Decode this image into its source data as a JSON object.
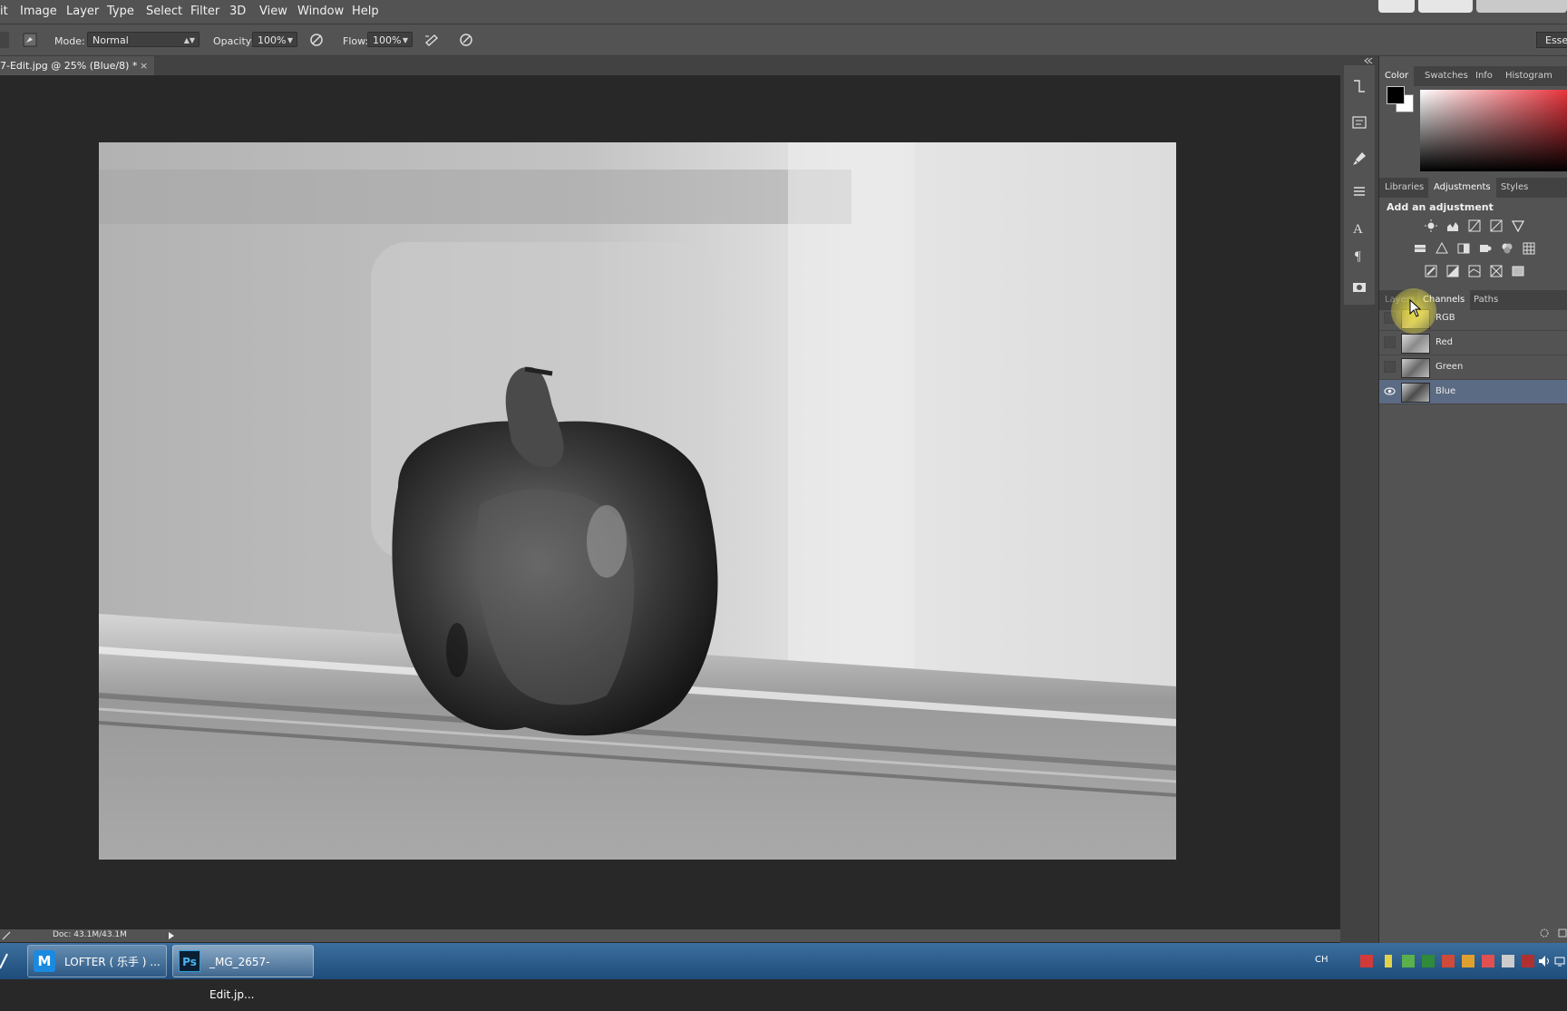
{
  "menu": {
    "items": [
      "it",
      "Image",
      "Layer",
      "Type",
      "Select",
      "Filter",
      "3D",
      "View",
      "Window",
      "Help"
    ]
  },
  "options": {
    "mode_label": "Mode:",
    "mode_value": "Normal",
    "opacity_label": "Opacity:",
    "opacity_value": "100%",
    "flow_label": "Flow:",
    "flow_value": "100%",
    "workspace": "Esser"
  },
  "document": {
    "tab_title": "7-Edit.jpg @ 25% (Blue/8) *",
    "close_glyph": "×",
    "status": "Doc: 43.1M/43.1M"
  },
  "panels": {
    "color_tabs": [
      "Color",
      "Swatches",
      "Info",
      "Histogram"
    ],
    "adj_tabs": [
      "Libraries",
      "Adjustments",
      "Styles"
    ],
    "adj_heading": "Add an adjustment",
    "channel_tabs": [
      "Layers",
      "Channels",
      "Paths"
    ],
    "channels": [
      {
        "name": "RGB",
        "visible": false
      },
      {
        "name": "Red",
        "visible": false
      },
      {
        "name": "Green",
        "visible": false
      },
      {
        "name": "Blue",
        "visible": true
      }
    ]
  },
  "taskbar": {
    "apps": [
      {
        "label": "LOFTER ( 乐手 ) ..."
      },
      {
        "label": "_MG_2657-Edit.jp..."
      }
    ],
    "ps_glyph": "Ps",
    "lang": "CH"
  },
  "colors": {
    "accent": "#5c6b84",
    "panel": "#535353",
    "canvas_bg": "#282828"
  }
}
